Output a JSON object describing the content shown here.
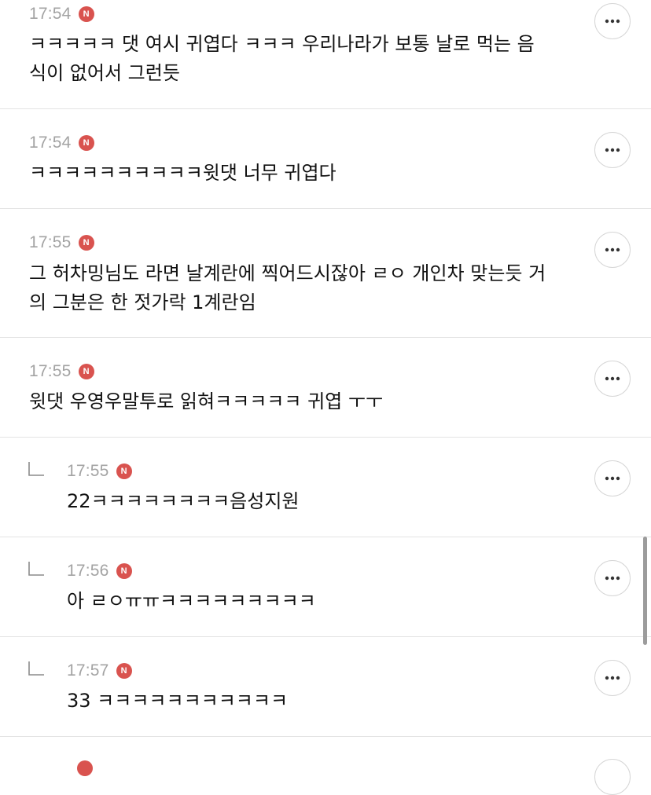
{
  "comments": [
    {
      "time": "17:54",
      "badge": "N",
      "text": "ㅋㅋㅋㅋㅋ 댓 여시 귀엽다 ㅋㅋㅋ 우리나라가 보통 날로 먹는 음\n식이 없어서 그런듯",
      "is_reply": false
    },
    {
      "time": "17:54",
      "badge": "N",
      "text": "ㅋㅋㅋㅋㅋㅋㅋㅋㅋㅋ윗댓 너무 귀엽다",
      "is_reply": false
    },
    {
      "time": "17:55",
      "badge": "N",
      "text": "그 허차밍님도 라면 날계란에 찍어드시잖아 ㄹㅇ 개인차 맞는듯 거\n의 그분은 한 젓가락 1계란임",
      "is_reply": false
    },
    {
      "time": "17:55",
      "badge": "N",
      "text": "윗댓 우영우말투로 읽혀ㅋㅋㅋㅋㅋ 귀엽 ㅜㅜ",
      "is_reply": false
    },
    {
      "time": "17:55",
      "badge": "N",
      "text": "22ㅋㅋㅋㅋㅋㅋㅋㅋ음성지원",
      "is_reply": true
    },
    {
      "time": "17:56",
      "badge": "N",
      "text": "아 ㄹㅇㅠㅠㅋㅋㅋㅋㅋㅋㅋㅋㅋ",
      "is_reply": true
    },
    {
      "time": "17:57",
      "badge": "N",
      "text": "33 ㅋㅋㅋㅋㅋㅋㅋㅋㅋㅋㅋ",
      "is_reply": true
    }
  ],
  "icons": {
    "more": "more-horizontal-icon",
    "reply": "reply-arrow-icon",
    "badge": "new-badge-icon"
  },
  "colors": {
    "time": "#a3a3a3",
    "badge": "#d9534f",
    "divider": "#e3e3e3",
    "text": "#111111"
  }
}
